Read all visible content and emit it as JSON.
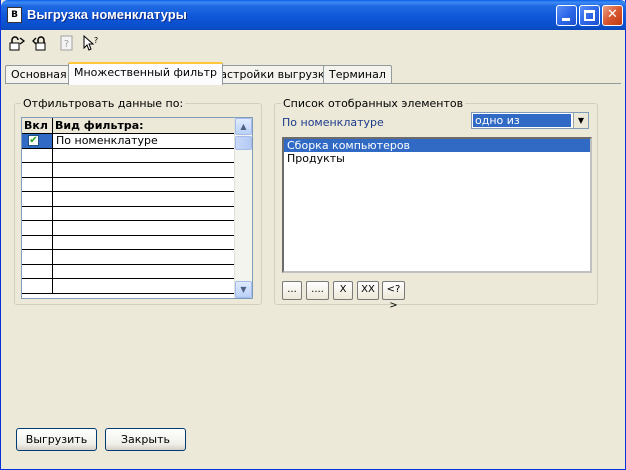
{
  "window": {
    "title": "Выгрузка номенклатуры",
    "icon_label": "В"
  },
  "toolbar": {
    "icons": [
      "lock-open-icon",
      "lock-closed-icon",
      "help-icon",
      "pointer-help-icon"
    ]
  },
  "tabs": [
    {
      "label": "Основная",
      "active": false
    },
    {
      "label": "Множественный фильтр",
      "active": true
    },
    {
      "label": "Настройки выгрузки",
      "active": false
    },
    {
      "label": "Терминал",
      "active": false
    }
  ],
  "filter_group": {
    "label": "Отфильтровать данные по:",
    "columns": [
      "Вкл",
      "Вид фильтра:"
    ],
    "rows": [
      {
        "checked": true,
        "name": "По номенклатуре"
      }
    ]
  },
  "selected_group": {
    "label": "Список отобранных элементов",
    "filter_label": "По номенклатуре",
    "condition_value": "одно из",
    "items": [
      {
        "label": "Сборка компьютеров",
        "selected": true
      },
      {
        "label": "Продукты",
        "selected": false
      }
    ],
    "buttons": [
      "...",
      "....",
      "X",
      "XX",
      "<?>"
    ]
  },
  "footer": {
    "export_label": "Выгрузить",
    "close_label": "Закрыть"
  },
  "colors": {
    "selection": "#316ac5",
    "titlebar": "#0a4ec9",
    "active_tab_accent": "#ffc83c",
    "link_text": "#1c3a8a"
  }
}
